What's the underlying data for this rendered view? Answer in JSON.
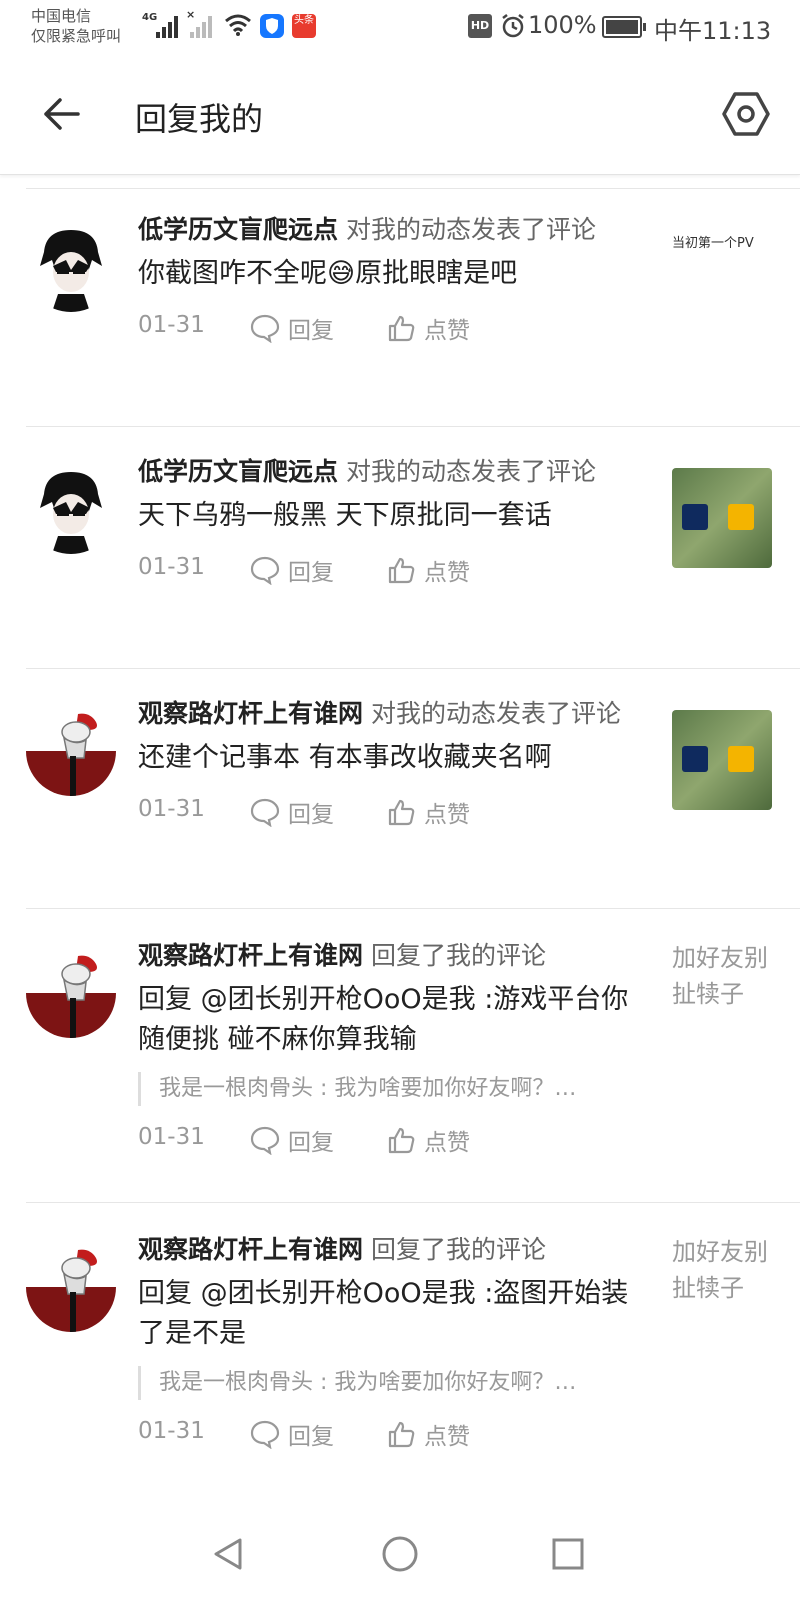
{
  "status_bar": {
    "carrier_line1": "中国电信",
    "carrier_line2": "仅限紧急呼叫",
    "network": "4G",
    "toutiao_label": "头条",
    "hd": "HD",
    "battery": "100%",
    "time": "中午11:13"
  },
  "header": {
    "title": "回复我的"
  },
  "items": [
    {
      "user": "低学历文盲爬远点",
      "action": "对我的动态发表了评论",
      "comment": "你截图咋不全呢😅原批眼瞎是吧",
      "date": "01-31",
      "reply_label": "回复",
      "like_label": "点赞",
      "thumb_text": "当初第一个PV"
    },
    {
      "user": "低学历文盲爬远点",
      "action": "对我的动态发表了评论",
      "comment": "天下乌鸦一般黑 天下原批同一套话",
      "date": "01-31",
      "reply_label": "回复",
      "like_label": "点赞"
    },
    {
      "user": "观察路灯杆上有谁网",
      "action": "对我的动态发表了评论",
      "comment": "还建个记事本 有本事改收藏夹名啊",
      "date": "01-31",
      "reply_label": "回复",
      "like_label": "点赞"
    },
    {
      "user": "观察路灯杆上有谁网",
      "action": "回复了我的评论",
      "comment": "回复 @团长别开枪OoO是我 :游戏平台你随便挑 碰不麻你算我输",
      "quote": "我是一根肉骨头 : 我为啥要加你好友啊？…",
      "date": "01-31",
      "reply_label": "回复",
      "like_label": "点赞",
      "side_text": "加好友别扯犊子"
    },
    {
      "user": "观察路灯杆上有谁网",
      "action": "回复了我的评论",
      "comment": "回复 @团长别开枪OoO是我 :盗图开始装了是不是",
      "quote": "我是一根肉骨头 : 我为啥要加你好友啊？…",
      "date": "01-31",
      "reply_label": "回复",
      "like_label": "点赞",
      "side_text": "加好友别扯犊子"
    }
  ]
}
